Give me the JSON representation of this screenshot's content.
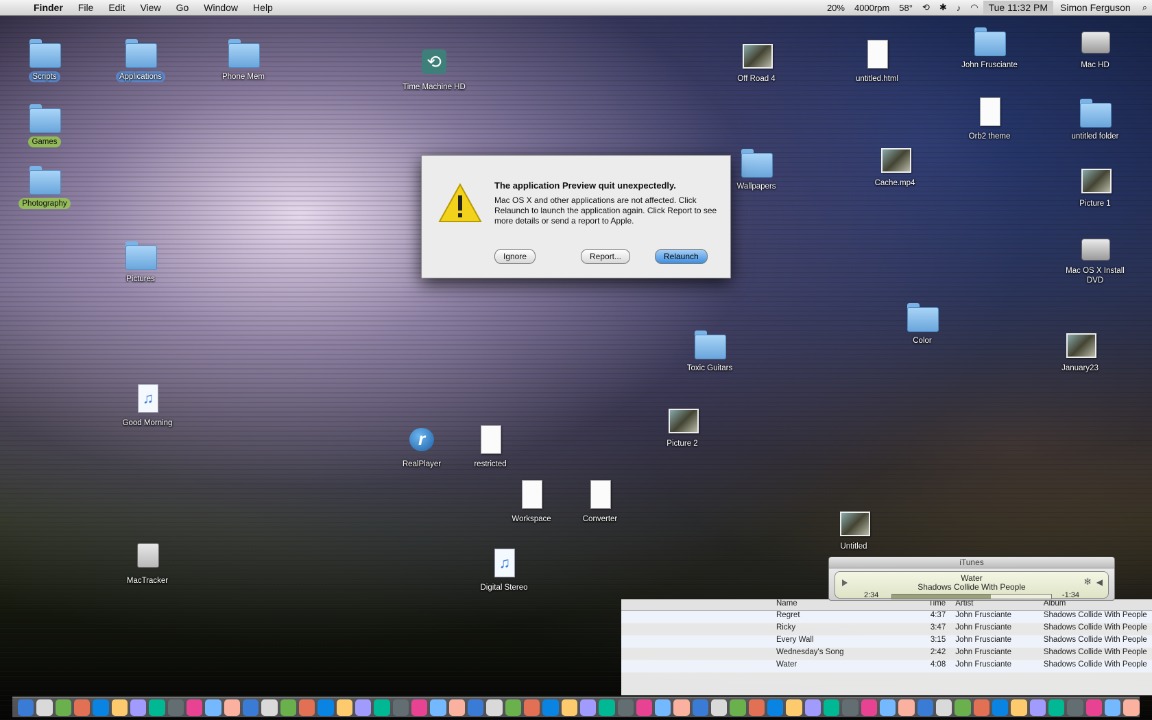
{
  "menubar": {
    "apple": "",
    "menus": [
      "Finder",
      "File",
      "Edit",
      "View",
      "Go",
      "Window",
      "Help"
    ],
    "extras": [
      "20%",
      "4000rpm",
      "58°"
    ],
    "clock": "Tue 11:32 PM",
    "user": "Simon Ferguson"
  },
  "desktop": {
    "icons": [
      {
        "name": "Scripts",
        "kind": "folder",
        "tag": "tag-blue"
      },
      {
        "name": "Applications",
        "kind": "folder",
        "tag": "tag-blue"
      },
      {
        "name": "Phone Mem",
        "kind": "folder",
        "tag": ""
      },
      {
        "name": "Games",
        "kind": "folder",
        "tag": "tag-green"
      },
      {
        "name": "Photography",
        "kind": "folder",
        "tag": "tag-green"
      },
      {
        "name": "Time Machine HD",
        "kind": "tm",
        "tag": ""
      },
      {
        "name": "Off Road 4",
        "kind": "photo",
        "tag": ""
      },
      {
        "name": "untitled.html",
        "kind": "doc",
        "tag": ""
      },
      {
        "name": "John Frusciante",
        "kind": "folder",
        "tag": ""
      },
      {
        "name": "Mac HD",
        "kind": "drive",
        "tag": ""
      },
      {
        "name": "Orb2 theme",
        "kind": "doc",
        "tag": ""
      },
      {
        "name": "untitled folder",
        "kind": "folder",
        "tag": ""
      },
      {
        "name": "Picture 1",
        "kind": "photo",
        "tag": ""
      },
      {
        "name": "Mac OS X Install DVD",
        "kind": "drive",
        "tag": ""
      },
      {
        "name": "Wallpapers",
        "kind": "folder",
        "tag": ""
      },
      {
        "name": "RealPlayer",
        "kind": "real",
        "tag": ""
      },
      {
        "name": "restricted",
        "kind": "doc",
        "tag": ""
      },
      {
        "name": "Workspace",
        "kind": "doc",
        "tag": ""
      },
      {
        "name": "Converter",
        "kind": "doc",
        "tag": ""
      },
      {
        "name": "Pictures",
        "kind": "folder",
        "tag": ""
      },
      {
        "name": "MacTracker",
        "kind": "mac",
        "tag": ""
      },
      {
        "name": "Good Morning",
        "kind": "ipa",
        "tag": ""
      },
      {
        "name": "Digital Stereo",
        "kind": "ipa",
        "tag": ""
      },
      {
        "name": "Color",
        "kind": "folder",
        "tag": ""
      },
      {
        "name": "January23",
        "kind": "photo",
        "tag": ""
      },
      {
        "name": "Cache.mp4",
        "kind": "photo",
        "tag": ""
      },
      {
        "name": "Toxic Guitars",
        "kind": "folder",
        "tag": ""
      },
      {
        "name": "Picture 2",
        "kind": "photo",
        "tag": ""
      },
      {
        "name": "Untitled",
        "kind": "photo",
        "tag": ""
      }
    ]
  },
  "alert": {
    "title": "The application Preview quit unexpectedly.",
    "message": "Mac OS X and other applications are not affected. Click Relaunch to launch the application again. Click Report to see more details or send a report to Apple.",
    "buttons": {
      "ignore": "Ignore",
      "report": "Report...",
      "relaunch": "Relaunch"
    }
  },
  "itunes": {
    "window_title": "iTunes",
    "track": "Water",
    "artist": "Shadows Collide With People",
    "elapsed": "2:34",
    "remaining": "-1:34",
    "progress_fraction": 0.62,
    "columns": {
      "name": "Name",
      "time": "Time",
      "artist": "Artist",
      "album": "Album"
    },
    "rows": [
      {
        "name": "Regret",
        "time": "4:37",
        "artist": "John Frusciante",
        "album": "Shadows Collide With People"
      },
      {
        "name": "Ricky",
        "time": "3:47",
        "artist": "John Frusciante",
        "album": "Shadows Collide With People"
      },
      {
        "name": "Every Wall",
        "time": "3:15",
        "artist": "John Frusciante",
        "album": "Shadows Collide With People"
      },
      {
        "name": "Wednesday's Song",
        "time": "2:42",
        "artist": "John Frusciante",
        "album": "Shadows Collide With People"
      },
      {
        "name": "Water",
        "time": "4:08",
        "artist": "John Frusciante",
        "album": "Shadows Collide With People"
      }
    ]
  },
  "colors": {
    "accent": "#3f8fe0",
    "menubar": "#e4e4e4",
    "lcd": "#dfe3c6"
  }
}
